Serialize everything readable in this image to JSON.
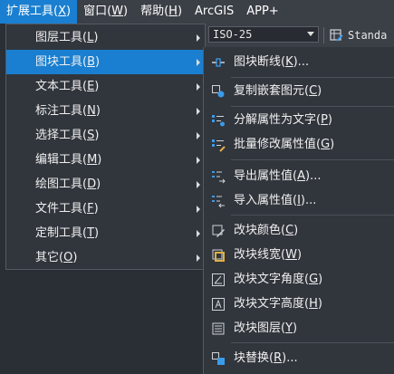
{
  "menubar": {
    "items": [
      {
        "label": "扩展工具(",
        "key": "X",
        "suffix": ")",
        "active": true
      },
      {
        "label": "窗口(",
        "key": "W",
        "suffix": ")"
      },
      {
        "label": "帮助(",
        "key": "H",
        "suffix": ")"
      },
      {
        "label": "ArcGIS",
        "key": "",
        "suffix": ""
      },
      {
        "label": "APP+",
        "key": "",
        "suffix": ""
      }
    ]
  },
  "toolbar": {
    "dimstyle_value": "ISO-25",
    "textstyle_value": "Standa"
  },
  "extension_menu": {
    "items": [
      {
        "label": "图层工具(",
        "key": "L",
        "suffix": ")"
      },
      {
        "label": "图块工具(",
        "key": "B",
        "suffix": ")",
        "highlighted": true
      },
      {
        "label": "文本工具(",
        "key": "E",
        "suffix": ")"
      },
      {
        "label": "标注工具(",
        "key": "N",
        "suffix": ")"
      },
      {
        "label": "选择工具(",
        "key": "S",
        "suffix": ")"
      },
      {
        "label": "编辑工具(",
        "key": "M",
        "suffix": ")"
      },
      {
        "label": "绘图工具(",
        "key": "D",
        "suffix": ")"
      },
      {
        "label": "文件工具(",
        "key": "F",
        "suffix": ")"
      },
      {
        "label": "定制工具(",
        "key": "T",
        "suffix": ")"
      },
      {
        "label": "其它(",
        "key": "O",
        "suffix": ")"
      }
    ]
  },
  "block_menu": {
    "items": [
      {
        "label": "图块断线(",
        "key": "K",
        "suffix": ")...",
        "icon": "block-break-icon"
      },
      {
        "label": "复制嵌套图元(",
        "key": "C",
        "suffix": ")",
        "icon": "copy-nested-icon"
      },
      {
        "label": "分解属性为文字(",
        "key": "P",
        "suffix": ")",
        "icon": "explode-attribute-icon"
      },
      {
        "label": "批量修改属性值(",
        "key": "G",
        "suffix": ")",
        "icon": "batch-attribute-icon"
      },
      {
        "label": "导出属性值(",
        "key": "A",
        "suffix": ")...",
        "icon": "export-attribute-icon"
      },
      {
        "label": "导入属性值(",
        "key": "I",
        "suffix": ")...",
        "icon": "import-attribute-icon"
      },
      {
        "label": "改块颜色(",
        "key": "C",
        "suffix": ")",
        "icon": "block-color-icon"
      },
      {
        "label": "改块线宽(",
        "key": "W",
        "suffix": ")",
        "icon": "block-lineweight-icon"
      },
      {
        "label": "改块文字角度(",
        "key": "G",
        "suffix": ")",
        "icon": "block-text-angle-icon"
      },
      {
        "label": "改块文字高度(",
        "key": "H",
        "suffix": ")",
        "icon": "block-text-height-icon"
      },
      {
        "label": "改块图层(",
        "key": "Y",
        "suffix": ")",
        "icon": "block-layer-icon"
      },
      {
        "label": "块替换(",
        "key": "R",
        "suffix": ")...",
        "icon": "block-replace-icon"
      }
    ]
  },
  "colors": {
    "highlight": "#1a7fd0",
    "menu_bg": "#31353c",
    "icon_blue": "#3a9be8",
    "icon_gray": "#cfd3d8"
  }
}
